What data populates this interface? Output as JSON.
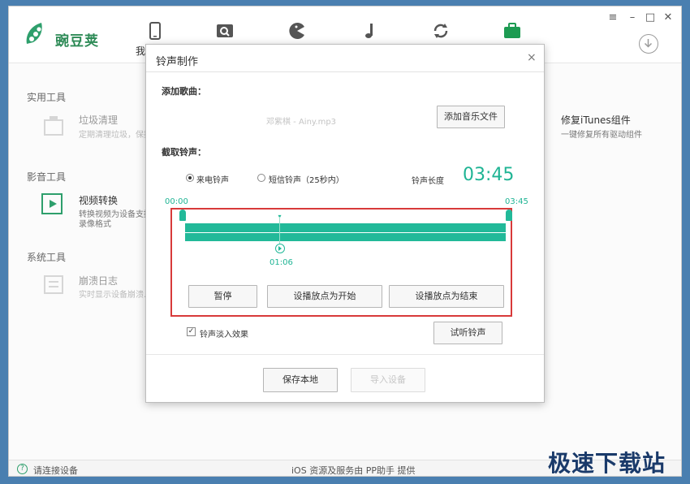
{
  "app": {
    "name": "豌豆荚",
    "nav_partial_label": "我",
    "window_controls": {
      "menu": "≡",
      "minimize": "–",
      "maximize": "□",
      "close": "✕"
    }
  },
  "tools": {
    "sections": [
      "实用工具",
      "影音工具",
      "系统工具"
    ],
    "items": [
      {
        "name": "垃圾清理",
        "desc": "定期清理垃圾，保持..."
      },
      {
        "name": "修复iTunes组件",
        "desc": "一键修复所有驱动组件"
      },
      {
        "name": "视频转换",
        "desc": "转换视频为设备支持",
        "desc2": "录像格式"
      },
      {
        "name": "崩溃日志",
        "desc": "实时显示设备崩溃..."
      }
    ]
  },
  "dialog": {
    "title": "铃声制作",
    "close": "×",
    "add_song_label": "添加歌曲：",
    "song_file": "邓紫棋 - Ainy.mp3",
    "add_music_button": "添加音乐文件",
    "cut_label": "截取铃声：",
    "radio_call": "来电铃声",
    "radio_sms": "短信铃声（25秒内）",
    "length_label": "铃声长度",
    "length_value": "03:45",
    "start_time": "00:00",
    "end_time": "03:45",
    "playhead_time": "01:06",
    "pause_button": "暂停",
    "set_start_button": "设播放点为开始",
    "set_end_button": "设播放点为结束",
    "fade_label": "铃声淡入效果",
    "preview_button": "试听铃声",
    "save_button": "保存本地",
    "import_button": "导入设备"
  },
  "status": {
    "connect": "请连接设备",
    "center": "iOS 资源及服务由 PP助手 提供"
  },
  "watermark": "极速下载站",
  "colors": {
    "accent": "#22b999",
    "highlight": "#d83a3a",
    "brand": "#2e8b57"
  }
}
